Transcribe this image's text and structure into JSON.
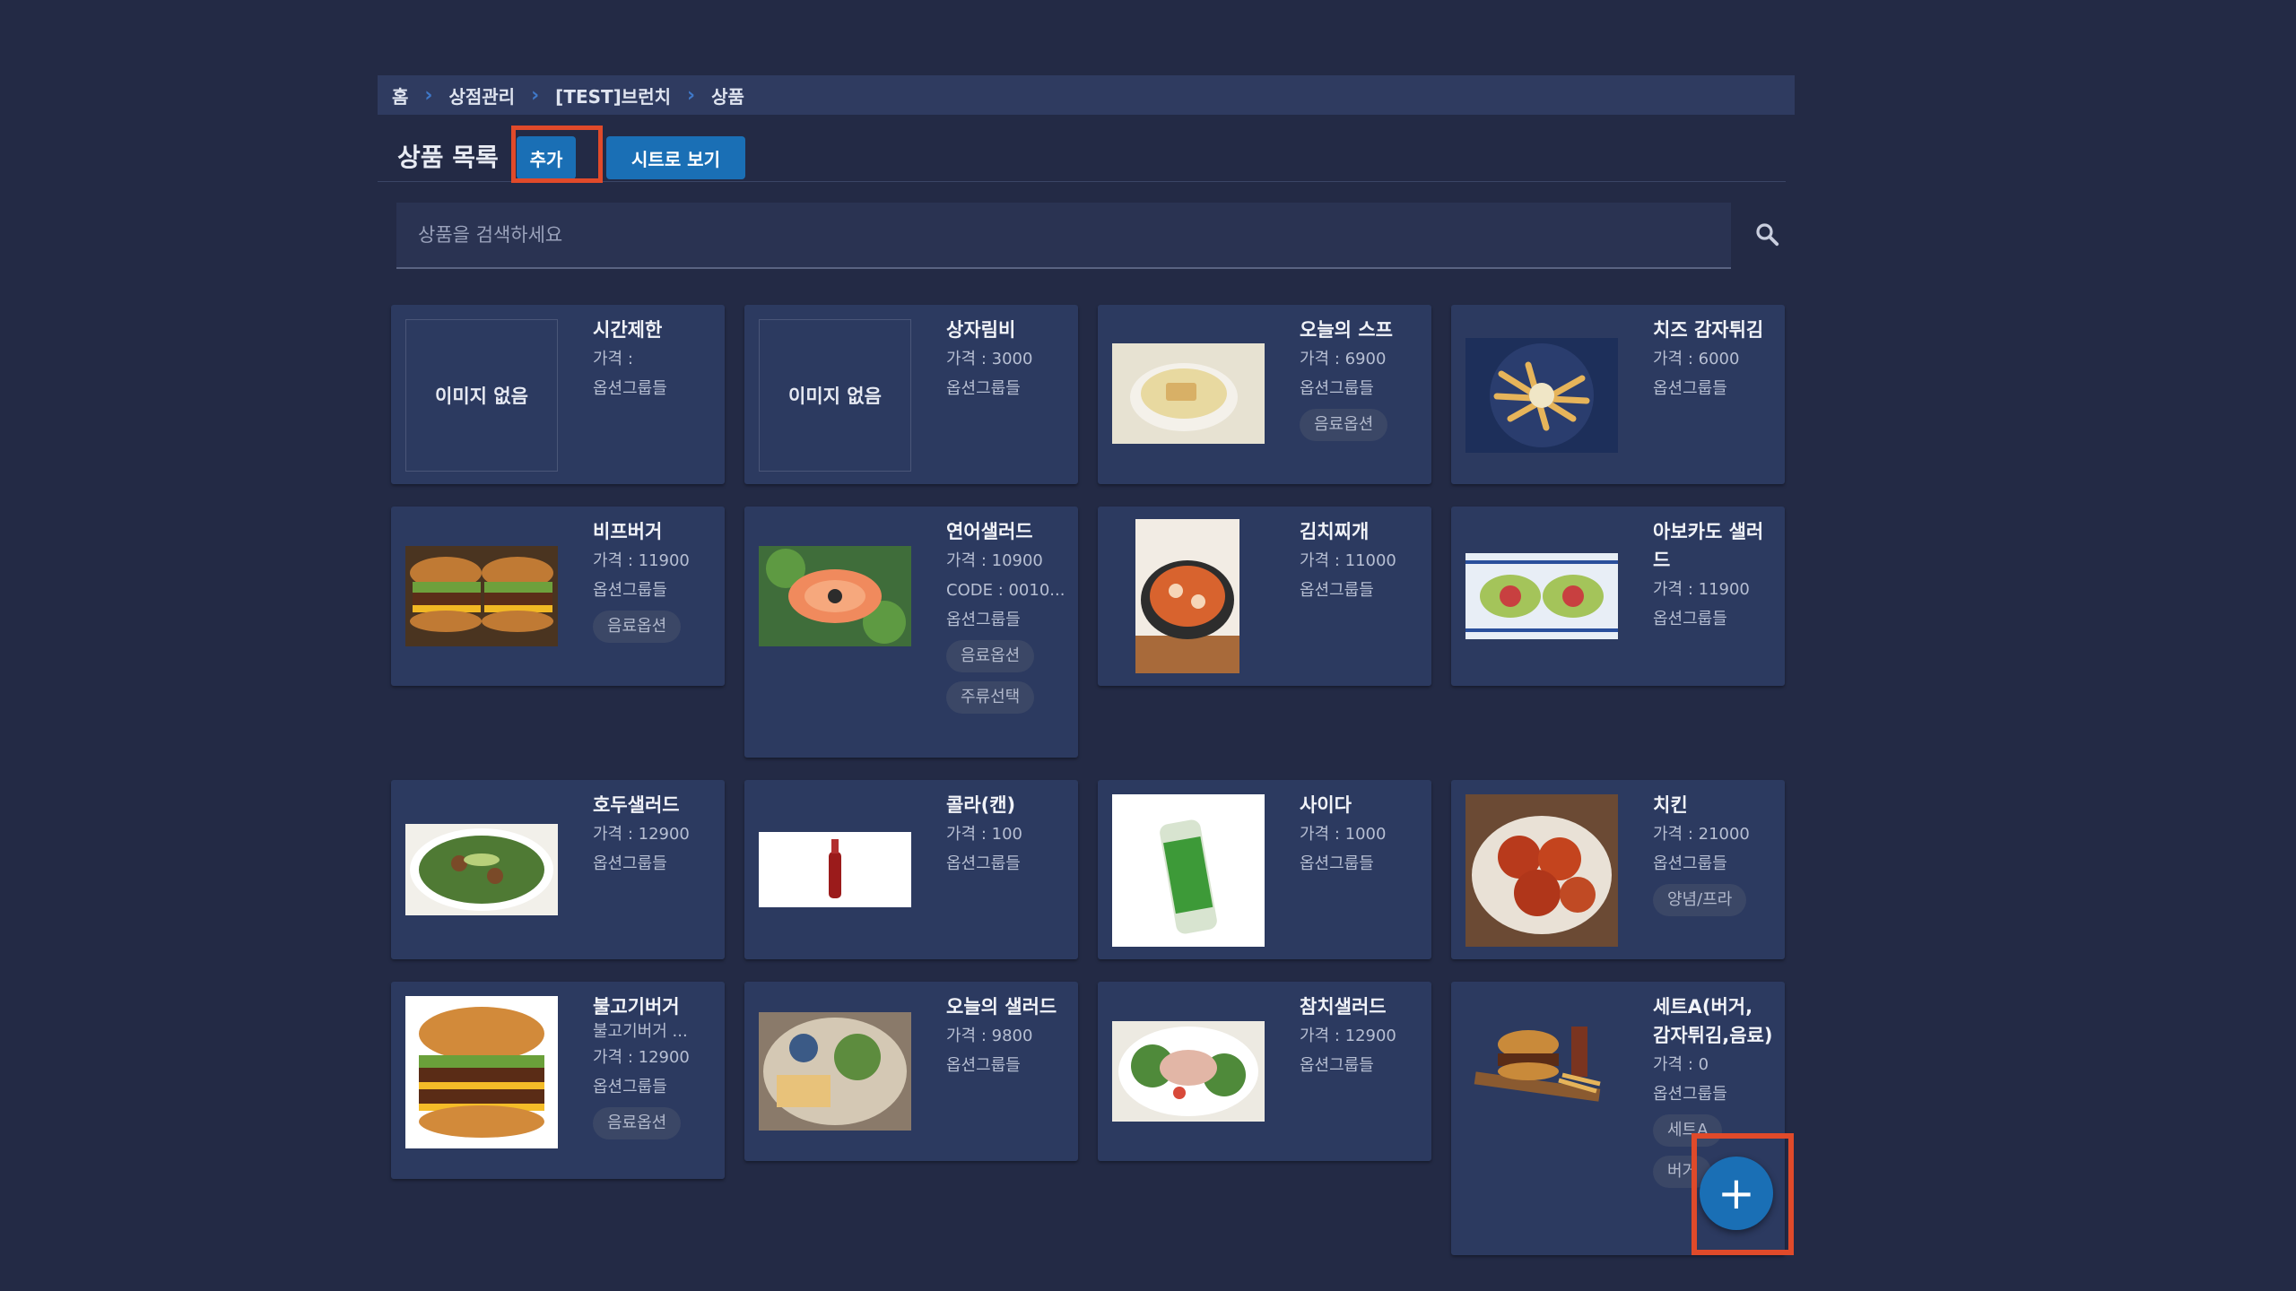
{
  "breadcrumb": {
    "items": [
      "홈",
      "상점관리",
      "[TEST]브런치",
      "상품"
    ],
    "separator": "›"
  },
  "header": {
    "title": "상품 목록",
    "add_label": "추가",
    "sheet_label": "시트로 보기"
  },
  "search": {
    "placeholder": "상품을 검색하세요",
    "value": ""
  },
  "products": [
    {
      "name": "시간제한",
      "lines": [
        "가격 :",
        "옵션그룹들"
      ],
      "chips": [],
      "image": "no-image",
      "noimg_label": "이미지 없음"
    },
    {
      "name": "상자림비",
      "lines": [
        "가격 : 3000",
        "옵션그룹들"
      ],
      "chips": [],
      "image": "no-image",
      "noimg_label": "이미지 없음"
    },
    {
      "name": "오늘의 스프",
      "lines": [
        "가격 : 6900",
        "옵션그룹들"
      ],
      "chips": [
        "음료옵션"
      ],
      "image": "soup"
    },
    {
      "name": "치즈 감자튀김",
      "lines": [
        "가격 : 6000",
        "옵션그룹들"
      ],
      "chips": [],
      "image": "fries"
    },
    {
      "name": "비프버거",
      "lines": [
        "가격 : 11900",
        "옵션그룹들"
      ],
      "chips": [
        "음료옵션"
      ],
      "image": "burger"
    },
    {
      "name": "연어샐러드",
      "lines": [
        "가격 : 10900",
        "CODE : 0010...",
        "옵션그룹들"
      ],
      "chips": [
        "음료옵션",
        "주류선택"
      ],
      "image": "salmon-salad"
    },
    {
      "name": "김치찌개",
      "lines": [
        "가격 : 11000",
        "옵션그룹들"
      ],
      "chips": [],
      "image": "kimchi-stew"
    },
    {
      "name": "아보카도 샐러드",
      "lines": [
        "가격 : 11900",
        "옵션그룹들"
      ],
      "chips": [],
      "image": "avocado"
    },
    {
      "name": "호두샐러드",
      "lines": [
        "가격 : 12900",
        "옵션그룹들"
      ],
      "chips": [],
      "image": "walnut-salad"
    },
    {
      "name": "콜라(캔)",
      "lines": [
        "가격 : 100",
        "옵션그룹들"
      ],
      "chips": [],
      "image": "cola"
    },
    {
      "name": "사이다",
      "lines": [
        "가격 : 1000",
        "옵션그룹들"
      ],
      "chips": [],
      "image": "cider"
    },
    {
      "name": "치킨",
      "lines": [
        "가격 : 21000",
        "옵션그룹들"
      ],
      "chips": [
        "양념/프라"
      ],
      "image": "chicken"
    },
    {
      "name": "불고기버거",
      "lines": [
        "불고기버거 ...",
        "가격 : 12900",
        "옵션그룹들"
      ],
      "chips": [
        "음료옵션"
      ],
      "image": "bulgogi-burger"
    },
    {
      "name": "오늘의 샐러드",
      "lines": [
        "가격 : 9800",
        "옵션그룹들"
      ],
      "chips": [],
      "image": "today-salad"
    },
    {
      "name": "참치샐러드",
      "lines": [
        "가격 : 12900",
        "옵션그룹들"
      ],
      "chips": [],
      "image": "tuna-salad"
    },
    {
      "name": "세트A(버거, 감자튀김,음료)",
      "lines": [
        "가격 : 0",
        "옵션그룹들"
      ],
      "chips": [
        "세트A",
        "버거"
      ],
      "image": "set-a"
    }
  ],
  "fab": {
    "label": "+"
  },
  "colors": {
    "background": "#232a45",
    "card": "#2c3a60",
    "accent": "#1a6fb5",
    "highlight": "#e04a2a"
  }
}
